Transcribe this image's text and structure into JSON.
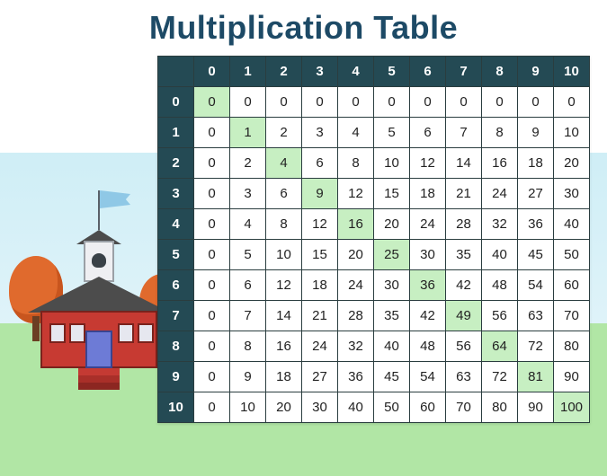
{
  "title": "Multiplication Table",
  "chart_data": {
    "type": "table",
    "title": "Multiplication Table",
    "row_headers": [
      0,
      1,
      2,
      3,
      4,
      5,
      6,
      7,
      8,
      9,
      10
    ],
    "col_headers": [
      0,
      1,
      2,
      3,
      4,
      5,
      6,
      7,
      8,
      9,
      10
    ],
    "values": [
      [
        0,
        0,
        0,
        0,
        0,
        0,
        0,
        0,
        0,
        0,
        0
      ],
      [
        0,
        1,
        2,
        3,
        4,
        5,
        6,
        7,
        8,
        9,
        10
      ],
      [
        0,
        2,
        4,
        6,
        8,
        10,
        12,
        14,
        16,
        18,
        20
      ],
      [
        0,
        3,
        6,
        9,
        12,
        15,
        18,
        21,
        24,
        27,
        30
      ],
      [
        0,
        4,
        8,
        12,
        16,
        20,
        24,
        28,
        32,
        36,
        40
      ],
      [
        0,
        5,
        10,
        15,
        20,
        25,
        30,
        35,
        40,
        45,
        50
      ],
      [
        0,
        6,
        12,
        18,
        24,
        30,
        36,
        42,
        48,
        54,
        60
      ],
      [
        0,
        7,
        14,
        21,
        28,
        35,
        42,
        49,
        56,
        63,
        70
      ],
      [
        0,
        8,
        16,
        24,
        32,
        40,
        48,
        56,
        64,
        72,
        80
      ],
      [
        0,
        9,
        18,
        27,
        36,
        45,
        54,
        63,
        72,
        81,
        90
      ],
      [
        0,
        10,
        20,
        30,
        40,
        50,
        60,
        70,
        80,
        90,
        100
      ]
    ],
    "highlight": "diagonal",
    "colors": {
      "header_bg": "#244a54",
      "header_fg": "#ffffff",
      "cell_bg": "#ffffff",
      "diagonal_bg": "#c7efc2",
      "border": "#2a3d3f"
    }
  },
  "illustration": {
    "description": "schoolhouse with bell tower and flag, autumn trees, grass foreground, blue sky"
  }
}
